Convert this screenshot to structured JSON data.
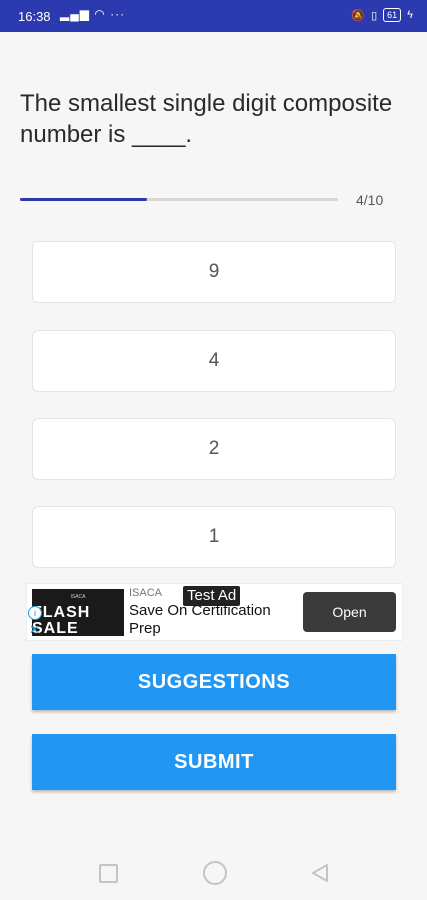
{
  "status_bar": {
    "time": "16:38",
    "left_icons": "▂▄▆ ◠ ···",
    "battery": "61"
  },
  "quiz": {
    "question": "The smallest single digit composite number is ____.",
    "progress_label": "4/10",
    "progress_fraction": 0.4,
    "options": [
      "9",
      "4",
      "2",
      "1"
    ]
  },
  "ad": {
    "image_small_text": "ISACA",
    "image_title": "FLASH SALE",
    "brand": "ISACA",
    "badge": "Test Ad",
    "text": "Save On Certification Prep",
    "cta": "Open",
    "info_icon": "i",
    "close_icon": "✕"
  },
  "buttons": {
    "suggestions": "SUGGESTIONS",
    "submit": "SUBMIT"
  },
  "colors": {
    "status_bar": "#2c3ab0",
    "progress": "#2a3aa8",
    "primary_button": "#2196f3"
  }
}
